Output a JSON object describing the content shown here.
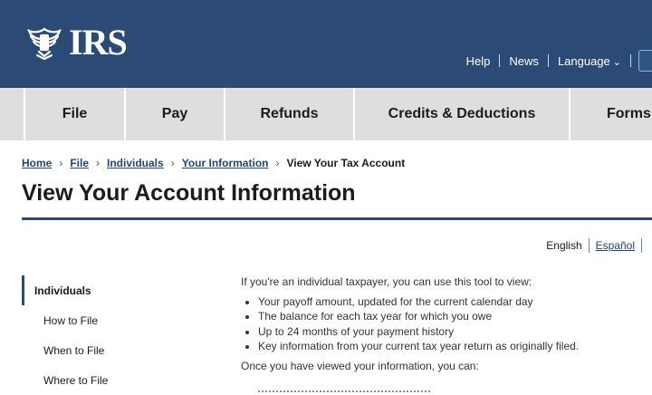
{
  "header": {
    "logo_text": "IRS",
    "utility_nav": [
      {
        "label": "Help"
      },
      {
        "label": "News"
      },
      {
        "label": "Language"
      }
    ],
    "background_color": "#2b4a75"
  },
  "main_nav": {
    "tabs": [
      {
        "label": "File"
      },
      {
        "label": "Pay"
      },
      {
        "label": "Refunds"
      },
      {
        "label": "Credits & Deductions"
      },
      {
        "label": "Forms"
      }
    ]
  },
  "breadcrumb": [
    {
      "label": "Home"
    },
    {
      "label": "File"
    },
    {
      "label": "Individuals"
    },
    {
      "label": "Your Information"
    },
    {
      "label": "View Your Tax Account"
    }
  ],
  "page_title": "View Your Account Information",
  "language_switch": {
    "current": "English",
    "alternate": "Español"
  },
  "sidebar": {
    "items": [
      {
        "label": "Individuals",
        "active": true
      },
      {
        "label": "How to File"
      },
      {
        "label": "When to File"
      },
      {
        "label": "Where to File"
      }
    ]
  },
  "content": {
    "intro": "If you're an individual taxpayer, you can use this tool to view:",
    "bullets": [
      "Your payoff amount, updated for the current calendar day",
      "The balance for each tax year for which you owe",
      "Up to 24 months of your payment history",
      "Key information from your current tax year return as originally filed."
    ],
    "followup": "Once you have viewed your information, you can:"
  },
  "colors": {
    "brand_navy": "#2b4a75",
    "nav_gray": "#dedede",
    "link_blue": "#21457a"
  }
}
